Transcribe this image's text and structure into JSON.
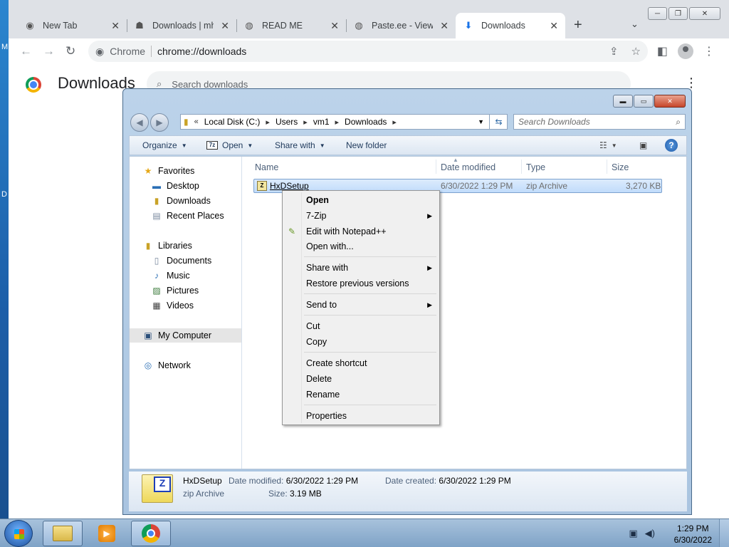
{
  "desktop": {
    "left_letters": [
      "M",
      "D"
    ]
  },
  "chrome": {
    "tabs": [
      {
        "title": "New Tab",
        "icon": "chrome-icon"
      },
      {
        "title": "Downloads | mh",
        "icon": "hat-icon"
      },
      {
        "title": "READ ME",
        "icon": "globe-icon"
      },
      {
        "title": "Paste.ee - View p",
        "icon": "globe-icon"
      },
      {
        "title": "Downloads",
        "icon": "download-icon",
        "active": true
      }
    ],
    "omnibox": {
      "label": "Chrome",
      "url": "chrome://downloads"
    },
    "page": {
      "title": "Downloads",
      "search_placeholder": "Search downloads"
    }
  },
  "explorer": {
    "breadcrumb": [
      "Local Disk (C:)",
      "Users",
      "vm1",
      "Downloads"
    ],
    "search_placeholder": "Search Downloads",
    "commands": {
      "organize": "Organize",
      "open": "Open",
      "share_with": "Share with",
      "new_folder": "New folder"
    },
    "nav": {
      "favorites": "Favorites",
      "desktop": "Desktop",
      "downloads": "Downloads",
      "recent": "Recent Places",
      "libraries": "Libraries",
      "documents": "Documents",
      "music": "Music",
      "pictures": "Pictures",
      "videos": "Videos",
      "computer": "My Computer",
      "network": "Network"
    },
    "columns": {
      "name": "Name",
      "date": "Date modified",
      "type": "Type",
      "size": "Size"
    },
    "file": {
      "name": "HxDSetup",
      "date": "6/30/2022 1:29 PM",
      "type": "zip Archive",
      "size": "3,270 KB"
    },
    "details": {
      "name": "HxDSetup",
      "type": "zip Archive",
      "modified_label": "Date modified:",
      "modified": "6/30/2022 1:29 PM",
      "created_label": "Date created:",
      "created": "6/30/2022 1:29 PM",
      "size_label": "Size:",
      "size": "3.19 MB"
    }
  },
  "context_menu": {
    "open": "Open",
    "zip": "7-Zip",
    "notepad": "Edit with Notepad++",
    "open_with": "Open with...",
    "share_with": "Share with",
    "restore": "Restore previous versions",
    "send_to": "Send to",
    "cut": "Cut",
    "copy": "Copy",
    "create_shortcut": "Create shortcut",
    "delete": "Delete",
    "rename": "Rename",
    "properties": "Properties"
  },
  "taskbar": {
    "time": "1:29 PM",
    "date": "6/30/2022"
  }
}
